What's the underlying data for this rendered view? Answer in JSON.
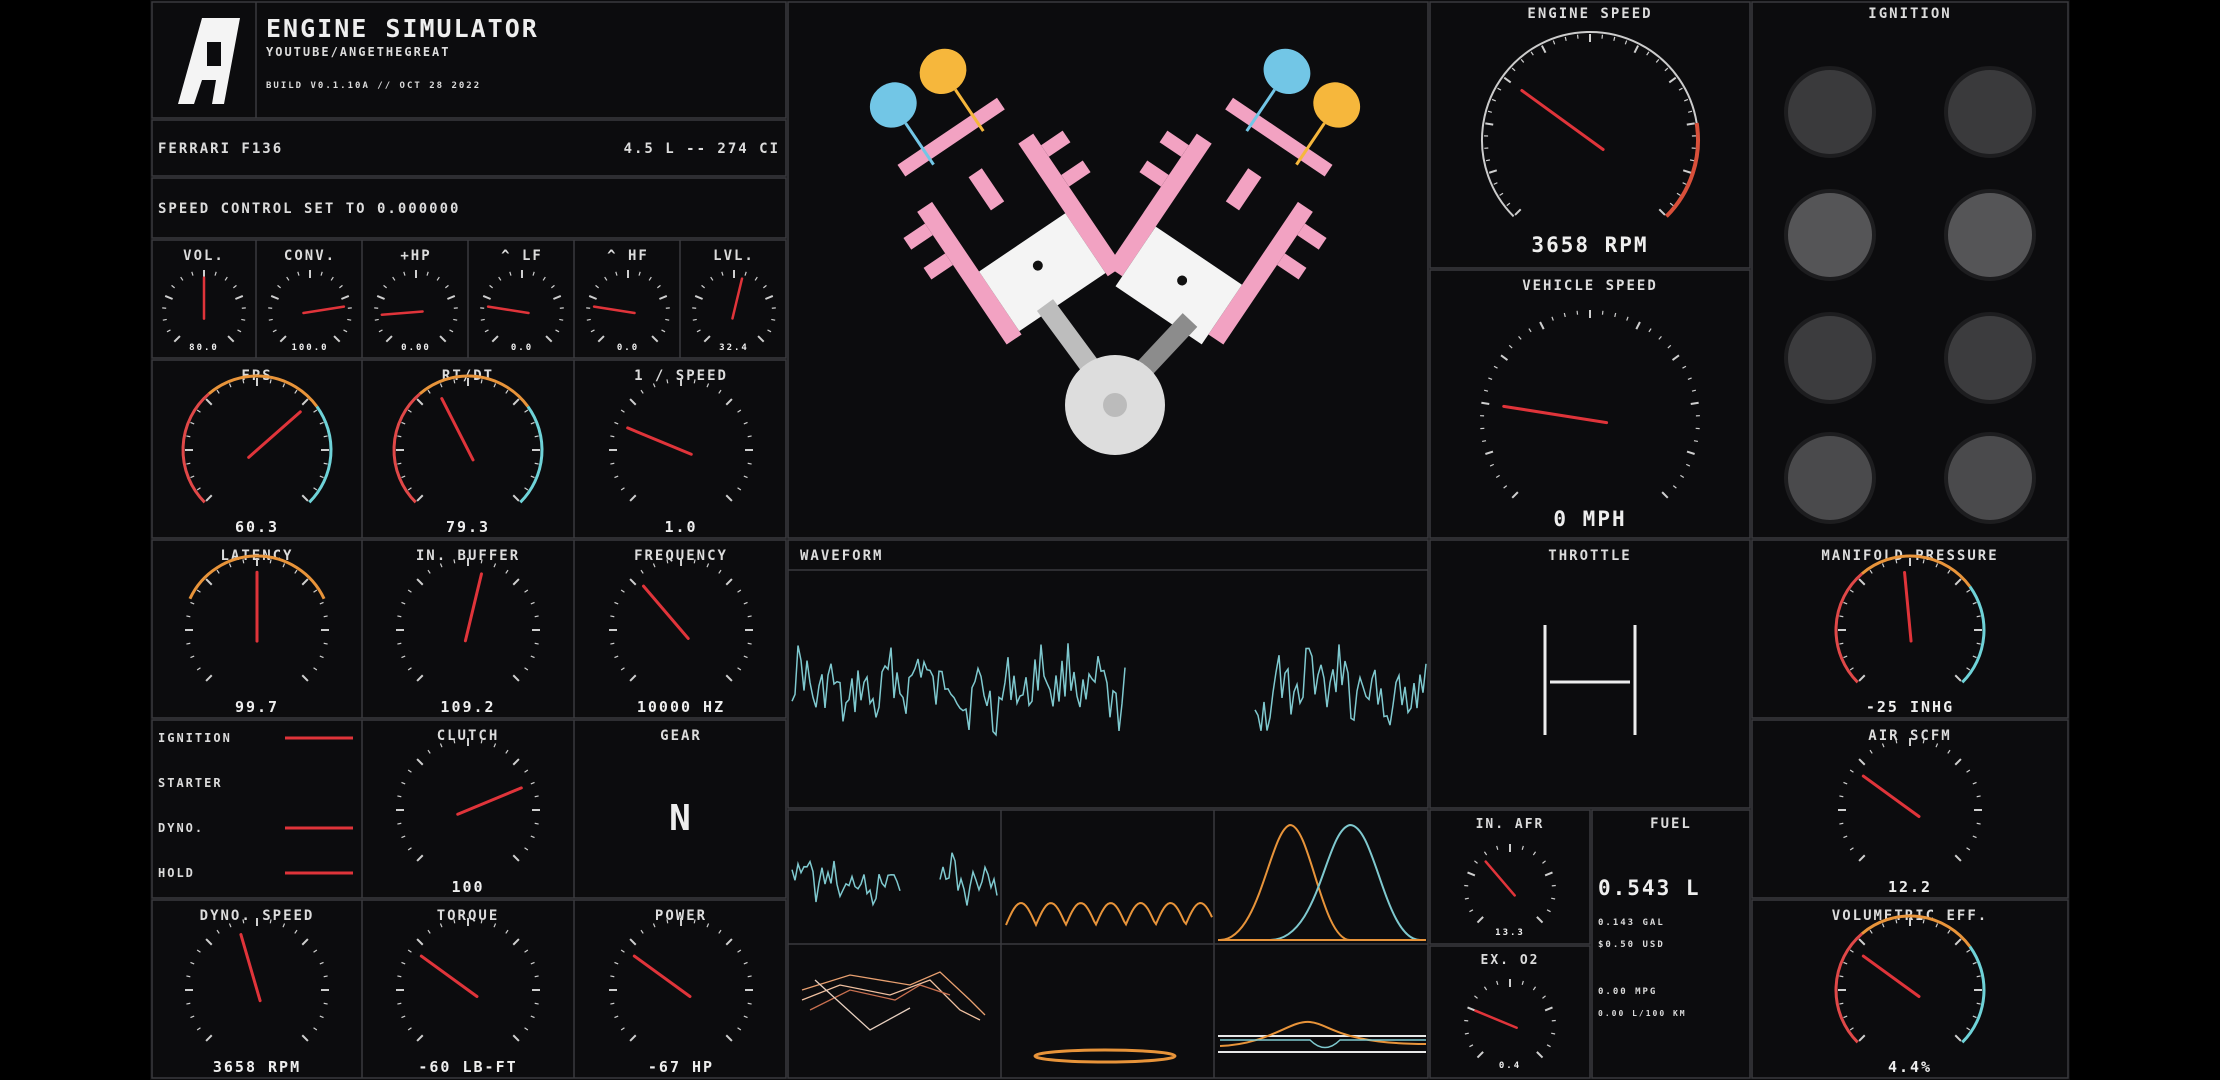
{
  "header": {
    "logo_letter": "A",
    "title": "ENGINE SIMULATOR",
    "subtitle": "YOUTUBE/ANGETHEGREAT",
    "build": "BUILD V0.1.10A // OCT 28 2022"
  },
  "engine_info": {
    "name": "FERRARI F136",
    "displacement": "4.5 L -- 274 CI"
  },
  "speed_control": "SPEED CONTROL SET TO 0.000000",
  "small_gauges": [
    {
      "label": "VOL.",
      "value": "80.0",
      "level": 0.5,
      "style": "white"
    },
    {
      "label": "CONV.",
      "value": "100.0",
      "level": 0.8,
      "style": "white"
    },
    {
      "label": "+HP",
      "value": "0.00",
      "level": 0.15,
      "style": "white"
    },
    {
      "label": "^ LF",
      "value": "0.0",
      "level": 0.2,
      "style": "white"
    },
    {
      "label": "^ HF",
      "value": "0.0",
      "level": 0.2,
      "style": "white"
    },
    {
      "label": "LVL.",
      "value": "32.4",
      "level": 0.55,
      "style": "white"
    }
  ],
  "gauges": {
    "fps": {
      "label": "FPS",
      "value": "60.3",
      "level": 0.68,
      "style": "color"
    },
    "rt_dt": {
      "label": "RT/DT",
      "value": "79.3",
      "level": 0.4,
      "style": "color"
    },
    "inv_speed": {
      "label": "1 / SPEED",
      "value": "1.0",
      "level": 0.25,
      "style": "white"
    },
    "latency": {
      "label": "LATENCY",
      "value": "99.7",
      "level": 0.5,
      "style": "warm"
    },
    "in_buffer": {
      "label": "IN. BUFFER",
      "value": "109.2",
      "level": 0.55,
      "style": "white"
    },
    "frequency": {
      "label": "FREQUENCY",
      "value": "10000 HZ",
      "level": 0.35,
      "style": "white"
    },
    "clutch": {
      "label": "CLUTCH",
      "value": "100",
      "level": 0.75,
      "style": "white"
    },
    "dyno_speed": {
      "label": "DYNO. SPEED",
      "value": "3658 RPM",
      "level": 0.44,
      "style": "white"
    },
    "torque": {
      "label": "TORQUE",
      "value": "-60 LB-FT",
      "level": 0.3,
      "style": "white"
    },
    "power": {
      "label": "POWER",
      "value": "-67 HP",
      "level": 0.3,
      "style": "white"
    },
    "engine_speed": {
      "label": "ENGINE SPEED",
      "value": "3658 RPM",
      "level": 0.3,
      "style": "redline"
    },
    "vehicle_speed": {
      "label": "VEHICLE SPEED",
      "value": "0 MPH",
      "level": 0.2,
      "style": "white"
    },
    "manifold": {
      "label": "MANIFOLD PRESSURE",
      "value": "-25 INHG",
      "level": 0.48,
      "style": "color"
    },
    "air_scfm": {
      "label": "AIR SCFM",
      "value": "12.2",
      "level": 0.3,
      "style": "white"
    },
    "vol_eff": {
      "label": "VOLUMETRIC EFF.",
      "value": "4.4%",
      "level": 0.3,
      "style": "color"
    },
    "in_afr": {
      "label": "IN. AFR",
      "value": "13.3",
      "level": 0.35,
      "style": "white"
    },
    "ex_o2": {
      "label": "EX. O2",
      "value": "0.4",
      "level": 0.25,
      "style": "white"
    }
  },
  "switches": [
    {
      "label": "IGNITION",
      "on": true
    },
    {
      "label": "STARTER",
      "on": false
    },
    {
      "label": "DYNO.",
      "on": true
    },
    {
      "label": "HOLD",
      "on": true
    }
  ],
  "gear": {
    "label": "GEAR",
    "value": "N"
  },
  "waveform": {
    "label": "WAVEFORM"
  },
  "throttle": {
    "label": "THROTTLE"
  },
  "ignition": {
    "label": "IGNITION"
  },
  "fuel": {
    "label": "FUEL",
    "main": "0.543 L",
    "lines": [
      "0.143 GAL",
      "$0.50 USD",
      "0.00 MPG",
      "0.00 L/100 KM"
    ]
  },
  "colors": {
    "background": "#0c0c0e",
    "frame": "#3a3a3e",
    "needle": "#e0343a",
    "cyan": "#6fd3d8",
    "orange": "#e8943a",
    "pink": "#f2a2c2",
    "blue": "#72c6e6",
    "yellow": "#f6b73c"
  }
}
